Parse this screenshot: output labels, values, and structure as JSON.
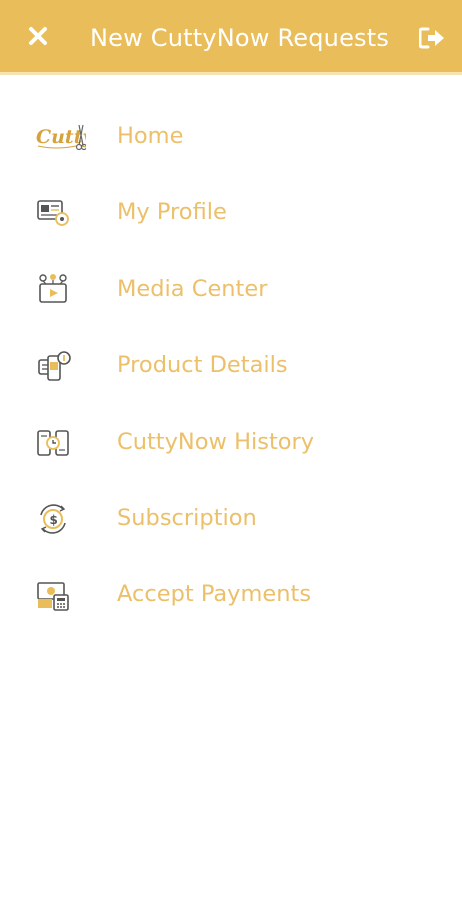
{
  "colors": {
    "header_bg": "#e9bd5a",
    "accent": "#ecc06a",
    "icon_dark": "#555555"
  },
  "header": {
    "title": "New CuttyNow Requests",
    "close_icon": "close-icon",
    "logout_icon": "logout-icon"
  },
  "logo": {
    "text": "Cutty"
  },
  "menu": {
    "items": [
      {
        "label": "Home",
        "icon": "cutty-logo-icon"
      },
      {
        "label": "My Profile",
        "icon": "profile-card-icon"
      },
      {
        "label": "Media Center",
        "icon": "media-center-icon"
      },
      {
        "label": "Product Details",
        "icon": "product-details-icon"
      },
      {
        "label": "CuttyNow History",
        "icon": "history-icon"
      },
      {
        "label": "Subscription",
        "icon": "subscription-icon"
      },
      {
        "label": "Accept Payments",
        "icon": "payments-icon"
      }
    ]
  }
}
